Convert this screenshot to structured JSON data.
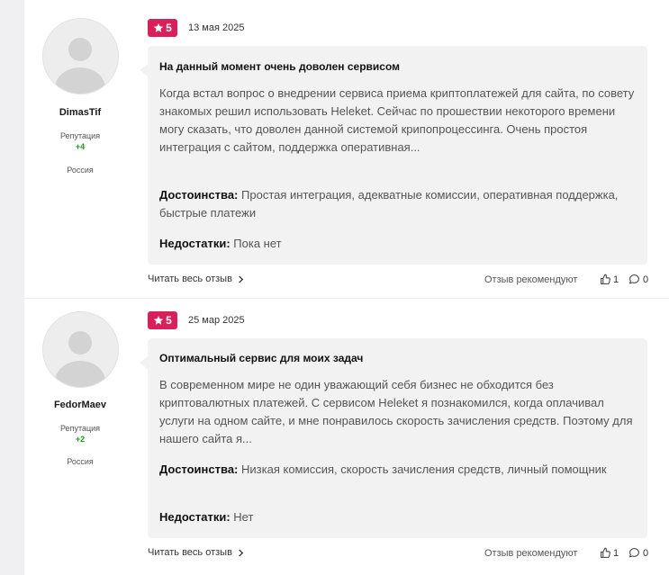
{
  "reviews": [
    {
      "author": "DimasTif",
      "reputation_label": "Репутация",
      "reputation_value": "+4",
      "country": "Россия",
      "rating": "5",
      "date": "13 мая 2025",
      "title": "На данный момент очень доволен сервисом",
      "text": "Когда встал вопрос о внедрении сервиса приема криптоплатежей для сайта, по совету знакомых решил использовать Heleket. Сейчас по прошествии некоторого времени могу сказать, что доволен данной системой крипопроцессинга. Очень простоя интеграция с сайтом, поддержка оперативная...",
      "pros_label": "Достоинства:",
      "pros": "Простая интеграция, адекватные комиссии, оперативная поддержка, быстрые платежи",
      "cons_label": "Недостатки:",
      "cons": "Пока нет",
      "read_more": "Читать весь отзыв",
      "recommend": "Отзыв рекомендуют",
      "likes": "1",
      "comments": "0"
    },
    {
      "author": "FedorMaev",
      "reputation_label": "Репутация",
      "reputation_value": "+2",
      "country": "Россия",
      "rating": "5",
      "date": "25 мар 2025",
      "title": "Оптимальный сервис для моих задач",
      "text": "В современном мире не один уважающий себя бизнес не обходится без криптовалютных платежей. С сервисом Heleket я познакомился, когда оплачивал услуги на одном сайте, и мне понравилось скорость зачисления средств. Поэтому для нашего сайта я...",
      "pros_label": "Достоинства:",
      "pros": "Низкая комиссия, скорость зачисления средств, личный помощник",
      "cons_label": "Недостатки:",
      "cons": "Нет",
      "read_more": "Читать весь отзыв",
      "recommend": "Отзыв рекомендуют",
      "likes": "1",
      "comments": "0"
    }
  ],
  "icons": {
    "star": "star-icon",
    "like": "thumbs-up-icon",
    "comment": "comment-bubble-icon",
    "chevron": "chevron-right-icon"
  },
  "colors": {
    "badge": "#d8205a",
    "reputation": "#1f9a1f",
    "bubble": "#f2f2f2"
  }
}
